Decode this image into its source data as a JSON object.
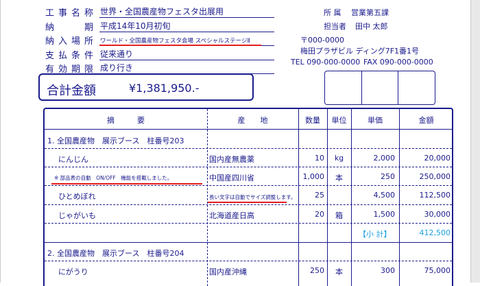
{
  "fields": [
    {
      "label": [
        "工",
        "事",
        "名",
        "称"
      ],
      "value": "世界・全国農産物フェスタ出展用"
    },
    {
      "label": [
        "納",
        "",
        "",
        "期"
      ],
      "value": "平成14年10月初旬"
    },
    {
      "label": [
        "納",
        "入",
        "場",
        "所"
      ],
      "value": "ワールド・全国農産物フェスタ会場 スペシャルステージⅡ"
    },
    {
      "label": [
        "支",
        "払",
        "条",
        "件"
      ],
      "value": "従来通り"
    },
    {
      "label": [
        "有",
        "効",
        "期",
        "限"
      ],
      "value": "成り行き"
    }
  ],
  "company": {
    "dept_label": "所 属",
    "dept": "営業第五課",
    "person_label": "担当者",
    "person": "田中 太郎",
    "postal": "〒000-0000",
    "address": "梅田プラザビル ディング7F1番1号",
    "tel": "TEL 090-000-0000",
    "fax": "FAX 090-000-0000"
  },
  "total": {
    "label": "合計金額",
    "value": "¥1,381,950.-"
  },
  "table": {
    "headers": {
      "summary": "摘　　　要",
      "origin": "産　　地",
      "qty": "数量",
      "unit": "単位",
      "price": "単価",
      "amount": "金額"
    },
    "sections": [
      {
        "title": "1. 全国農産物　展示ブース　柱番号203"
      },
      {
        "title": "2. 全国農産物　展示ブース　柱番号204"
      }
    ],
    "rows": [
      {
        "name": "にんじん",
        "origin": "国内産無農薬",
        "qty": "10",
        "unit": "kg",
        "price": "2,000",
        "amount": "20,000"
      },
      {
        "name": "※ 部品表の自動　ON/OFF　機能を搭載しました。",
        "origin": "中国産四川省",
        "qty": "1,000",
        "unit": "本",
        "price": "250",
        "amount": "250,000"
      },
      {
        "name": "ひとめぼれ",
        "origin": "長い文字は自動でサイズ調整します。",
        "qty": "25",
        "unit": "",
        "price": "4,500",
        "amount": "112,500"
      },
      {
        "name": "じゃがいも",
        "origin": "北海道産日高",
        "qty": "20",
        "unit": "箱",
        "price": "1,500",
        "amount": "30,000"
      },
      {
        "name": "",
        "origin": "",
        "qty": "",
        "unit": "",
        "price": "【小 計】",
        "amount": "412,500"
      },
      {
        "name": "にがうり",
        "origin": "国内産沖縄",
        "qty": "250",
        "unit": "本",
        "price": "300",
        "amount": "75,000"
      }
    ]
  },
  "colors": {
    "ink": "#1a1a8c",
    "accent_red": "#e41e1e",
    "subtotal": "#1aa0e0"
  }
}
